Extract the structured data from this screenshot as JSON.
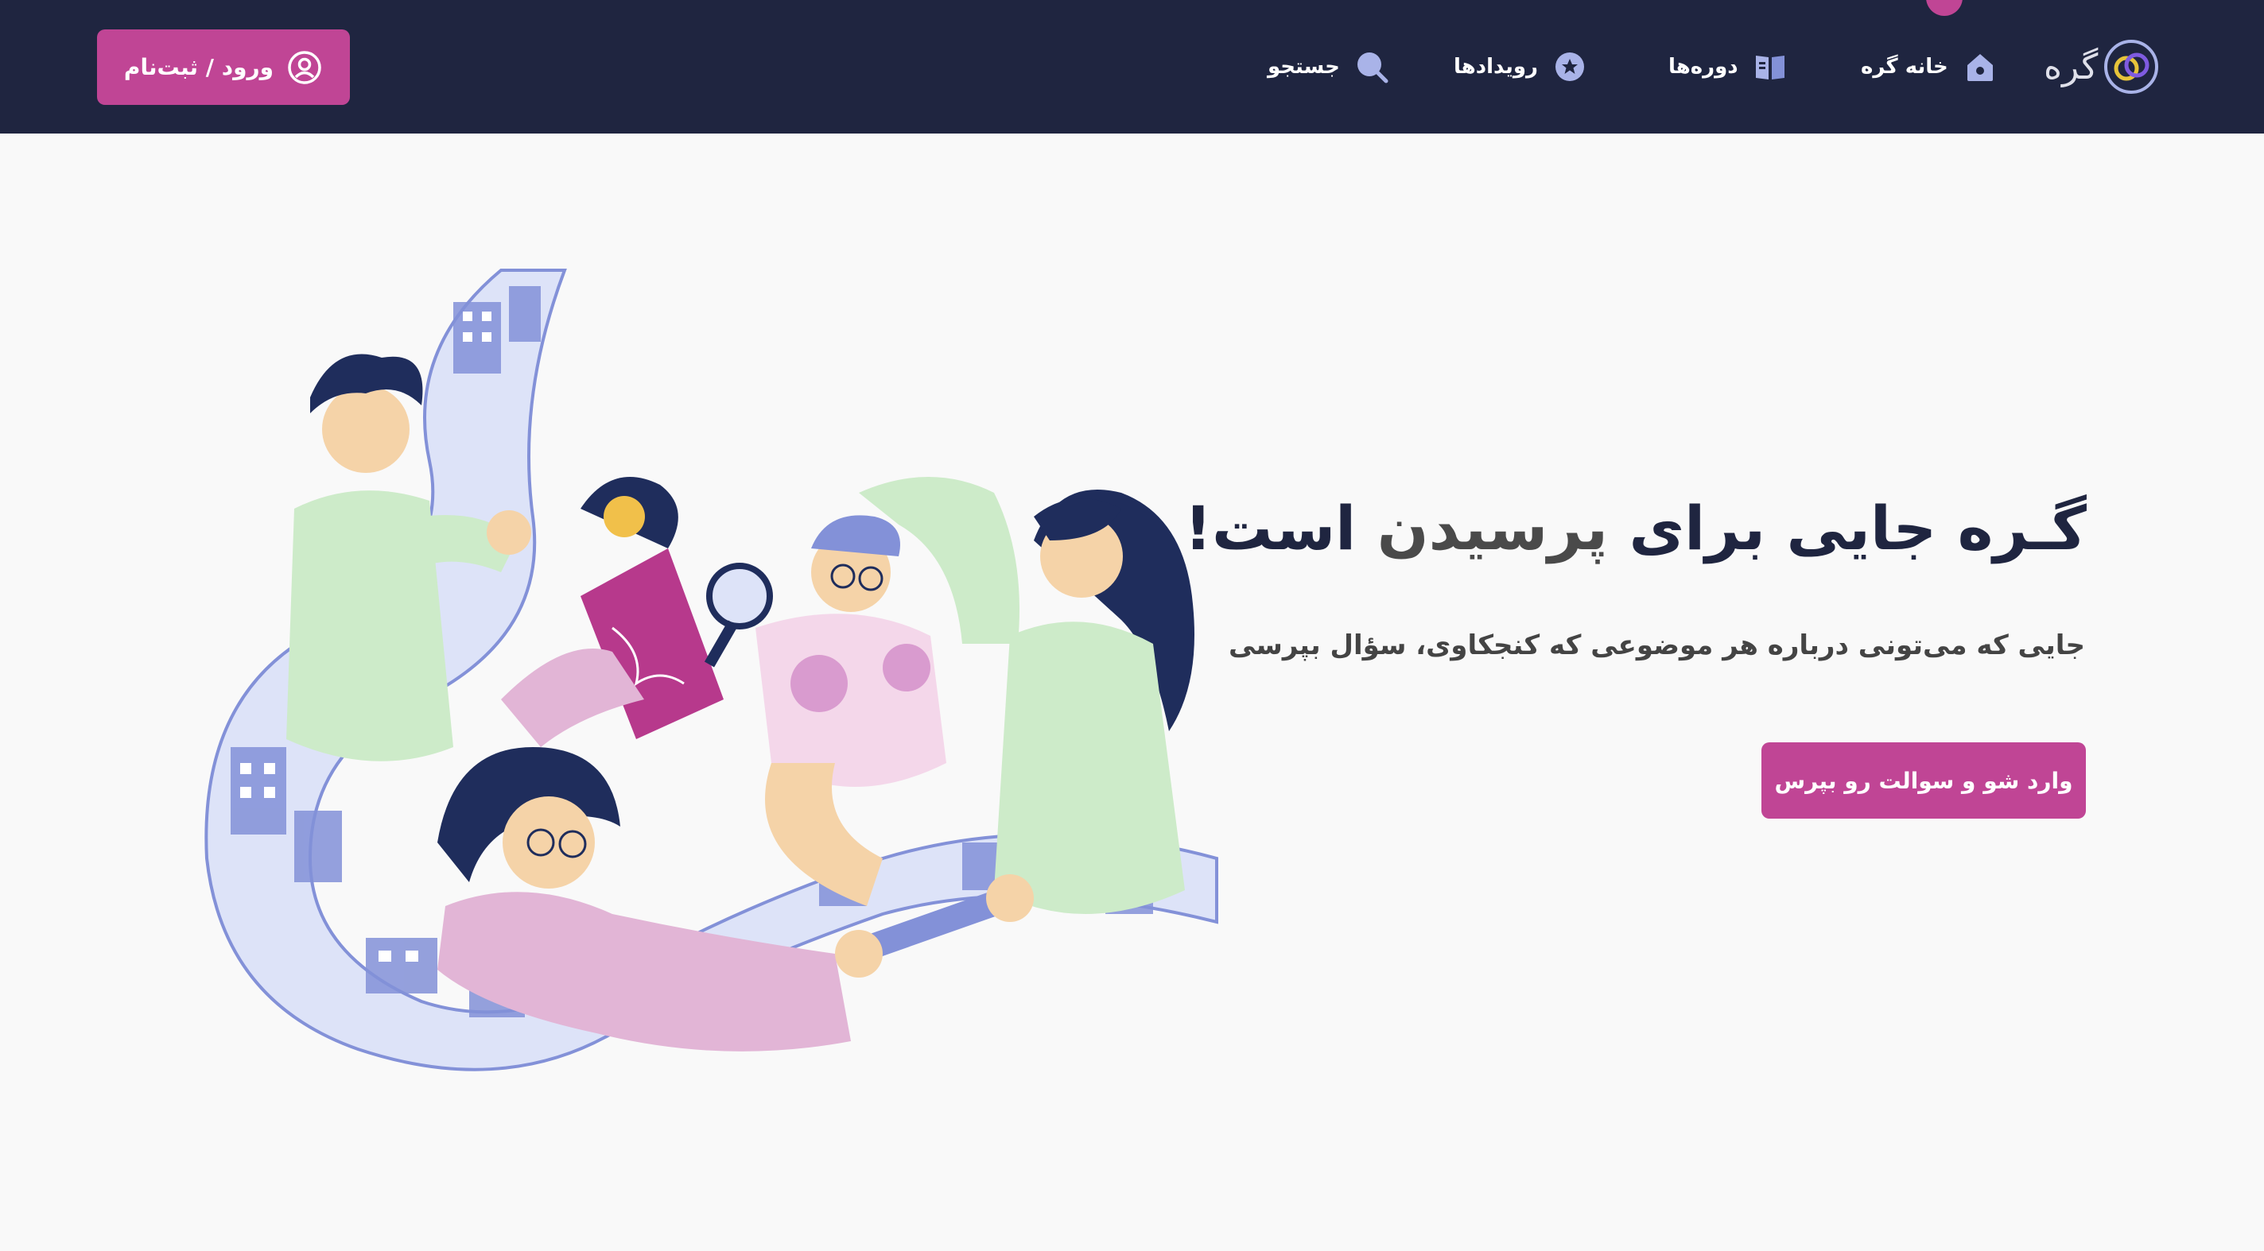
{
  "colors": {
    "navbar_bg": "#1f2540",
    "accent": "#c04595",
    "page_bg": "#f9f9f9",
    "nav_icon": "#a9b3e8"
  },
  "brand": {
    "name": "گره",
    "logo_icon": "linked-rings-logo"
  },
  "nav": {
    "items": [
      {
        "label": "خانه گره",
        "icon": "home-icon"
      },
      {
        "label": "دوره‌ها",
        "icon": "book-icon"
      },
      {
        "label": "رویدادها",
        "icon": "star-badge-icon"
      },
      {
        "label": "جستجو",
        "icon": "search-icon"
      }
    ]
  },
  "auth": {
    "login_label": "ورود / ثبت‌نام",
    "icon": "user-circle-icon"
  },
  "hero": {
    "title_part1": "گـره جایی برای ",
    "title_highlight": "پرسیدن",
    "title_part2": " است!",
    "subtitle": "جایی که می‌تونی درباره هر موضوعی که کنجکاوی، سؤال بپرسی",
    "cta_label": "وارد شو و سوالت رو بپرس",
    "illustration": "people-asking-questions-city-illustration"
  }
}
